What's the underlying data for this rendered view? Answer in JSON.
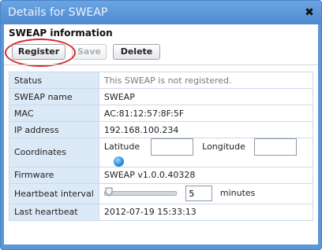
{
  "dialog": {
    "title": "Details for SWEAP",
    "close_glyph": "✖"
  },
  "section_title": "SWEAP information",
  "buttons": {
    "register": "Register",
    "save": "Save",
    "delete": "Delete"
  },
  "fields": {
    "status": {
      "label": "Status",
      "value": "This SWEAP is not registered."
    },
    "name": {
      "label": "SWEAP name",
      "value": "SWEAP"
    },
    "mac": {
      "label": "MAC",
      "value": "AC:81:12:57:8F:5F"
    },
    "ip": {
      "label": "IP address",
      "value": "192.168.100.234"
    },
    "coordinates": {
      "label": "Coordinates",
      "latitude_label": "Latitude",
      "latitude_value": "",
      "longitude_label": "Longitude",
      "longitude_value": ""
    },
    "firmware": {
      "label": "Firmware",
      "value": "SWEAP v1.0.0.40328"
    },
    "heartbeat_interval": {
      "label": "Heartbeat interval",
      "value": "5",
      "unit": "minutes",
      "slider_level": 0.0
    },
    "last_heartbeat": {
      "label": "Last heartbeat",
      "value": "2012-07-19 15:33:13"
    }
  },
  "icons": {
    "globe": "globe-icon",
    "close": "close-icon",
    "slider_thumb": "slider-thumb"
  },
  "colors": {
    "title_bar": "#5b96d6",
    "label_cell": "#dce9f7",
    "highlight_ring": "#d8282a"
  }
}
